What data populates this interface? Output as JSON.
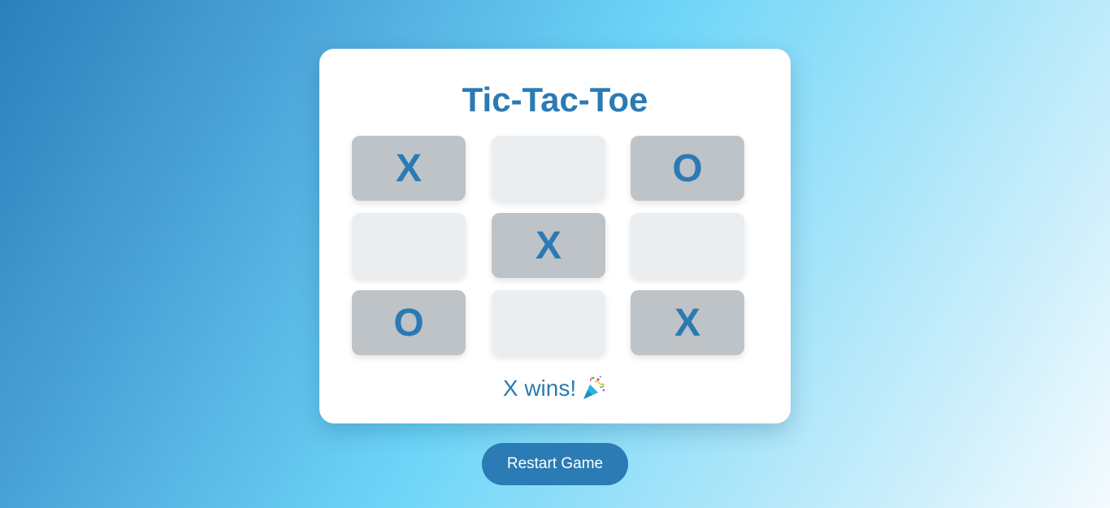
{
  "game": {
    "title": "Tic-Tac-Toe",
    "board": [
      {
        "mark": "X"
      },
      {
        "mark": ""
      },
      {
        "mark": "O"
      },
      {
        "mark": ""
      },
      {
        "mark": "X"
      },
      {
        "mark": ""
      },
      {
        "mark": "O"
      },
      {
        "mark": ""
      },
      {
        "mark": "X"
      }
    ],
    "status": "X wins!",
    "status_icon": "party-popper-icon",
    "restart_label": "Restart Game"
  },
  "colors": {
    "accent": "#2b7ab4",
    "filled_cell": "#bec3c7",
    "empty_cell": "#ebeef0"
  }
}
